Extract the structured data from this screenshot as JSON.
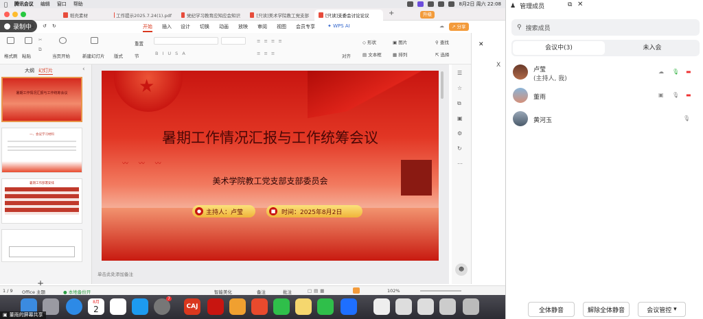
{
  "menubar": {
    "app": "腾讯会议",
    "items": [
      "编辑",
      "窗口",
      "帮助"
    ],
    "datetime": "8月2日 周六 22:08"
  },
  "tabs": [
    {
      "label": "稻壳素材",
      "color": "#e74c3c"
    },
    {
      "label": "工作提示2025.7.24(1).pdf",
      "color": "#e74c3c"
    },
    {
      "label": "党纪学习教育应知应会知识",
      "color": "#e74c3c"
    },
    {
      "label": "[只读]美术学院教工党支部",
      "color": "#e74c3c"
    },
    {
      "label": "[只读]支委会讨论论议",
      "color": "#e74c3c"
    }
  ],
  "tab_buttons": {
    "new": "+",
    "upgrade": "升级",
    "share": "分享"
  },
  "ribbon_tabs": [
    "开始",
    "插入",
    "设计",
    "切换",
    "动画",
    "放映",
    "审阅",
    "视图",
    "会员专享"
  ],
  "ribbon_active": "开始",
  "wps_ai": "WPS AI",
  "toolbar": {
    "format_painter": "格式刷",
    "paste": "粘贴",
    "play_from_current": "当页开始",
    "new_slide": "新建幻灯片",
    "layout": "版式",
    "section": "节",
    "reset": "重置",
    "align": "对齐",
    "shape": "形状",
    "picture": "图片",
    "find": "查找",
    "textbox": "文本框",
    "arrange": "排列",
    "select": "选择"
  },
  "left_pane": {
    "tab_outline": "大纲",
    "tab_slides": "幻灯片",
    "add": "+"
  },
  "slide": {
    "title": "暑期工作情况汇报与工作统筹会议",
    "subtitle": "美术学院教工党支部支部委员会",
    "host": "主持人：卢莹",
    "time": "时间：2025年8月2日"
  },
  "thumbs": [
    {
      "text": "暑期工作情况汇报与工作统筹会议"
    },
    {
      "text": "一、会议学习材料"
    },
    {
      "text": "暑期工作部署安排"
    },
    {
      "text": ""
    }
  ],
  "notes_placeholder": "单击此处添加备注",
  "statusbar": {
    "page": "1 / 9",
    "theme": "Office 主题",
    "backup": "本地备份开",
    "beautify": "智能美化",
    "notes": "备注",
    "comments": "批注",
    "zoom": "102%"
  },
  "record": {
    "label": "录制中"
  },
  "members": {
    "title": "管理成员",
    "search_placeholder": "搜索成员",
    "tab_in_meeting": "会议中(3)",
    "tab_not_joined": "未入会",
    "list": [
      {
        "name": "卢莹",
        "role": "(主持人, 我)"
      },
      {
        "name": "董雨",
        "role": ""
      },
      {
        "name": "黄河玉",
        "role": ""
      }
    ],
    "mute_all": "全体静音",
    "unmute_all": "解除全体静音",
    "control": "会议管控"
  },
  "screen_share_label": "董雨的屏幕共享",
  "dock": {
    "cal_month": "8月",
    "cal_day": "2",
    "caj": "CAJ",
    "badge_count": "7"
  },
  "colors": {
    "accent": "#d9381e",
    "gold": "#f6c34a",
    "green_mic": "#3bb54a"
  }
}
